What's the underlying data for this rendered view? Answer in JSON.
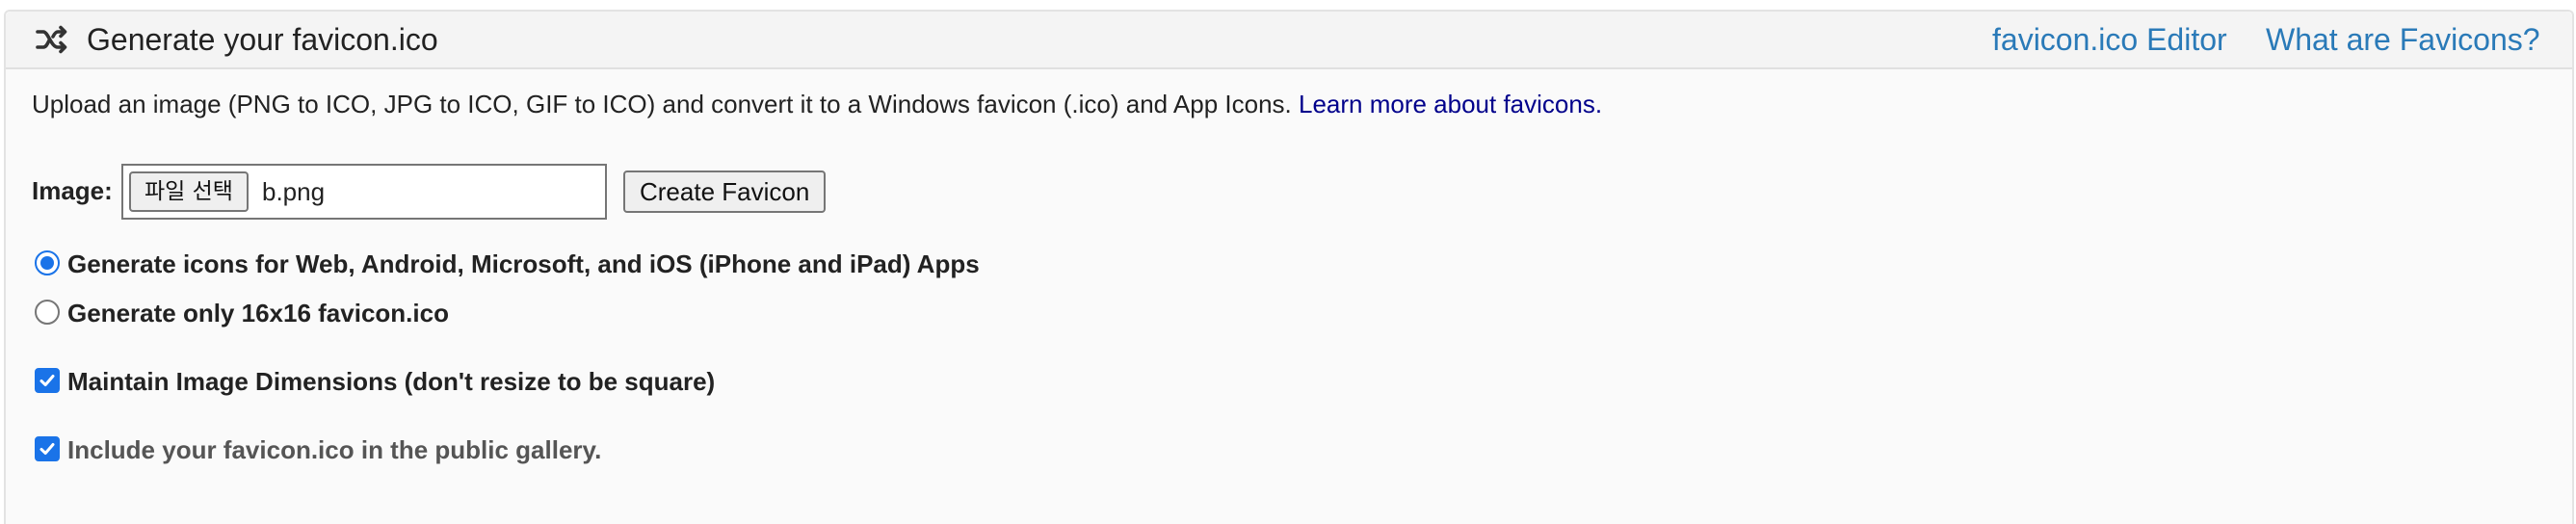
{
  "header": {
    "title": "Generate your favicon.ico",
    "icon": "shuffle-icon",
    "links": [
      {
        "label": "favicon.ico Editor"
      },
      {
        "label": "What are Favicons?"
      }
    ]
  },
  "intro": {
    "text": "Upload an image (PNG to ICO, JPG to ICO, GIF to ICO) and convert it to a Windows favicon (.ico) and App Icons. ",
    "link_label": "Learn more about favicons."
  },
  "form": {
    "image_label": "Image:",
    "file_button_label": "파일 선택",
    "file_name": "b.png",
    "create_button_label": "Create Favicon"
  },
  "options": {
    "radio_all": {
      "label": "Generate icons for Web, Android, Microsoft, and iOS (iPhone and iPad) Apps",
      "checked": true
    },
    "radio_only16": {
      "label": "Generate only 16x16 favicon.ico",
      "checked": false
    },
    "maintain_dimensions": {
      "label": "Maintain Image Dimensions (don't resize to be square)",
      "checked": true
    },
    "public_gallery": {
      "label": "Include your favicon.ico in the public gallery.",
      "checked": true
    }
  },
  "colors": {
    "link": "#2a7ab8",
    "intro_link": "#00008b",
    "accent": "#1a73e8"
  }
}
